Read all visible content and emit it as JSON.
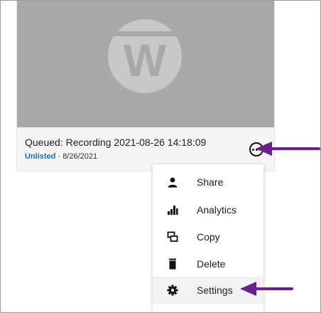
{
  "video": {
    "title": "Queued: Recording 2021-08-26 14:18:09",
    "visibility": "Unlisted",
    "separator": " · ",
    "date": "8/26/2021",
    "logo_letter": "W"
  },
  "menu": {
    "items": [
      {
        "label": "Share",
        "icon": "person-icon"
      },
      {
        "label": "Analytics",
        "icon": "bar-chart-icon"
      },
      {
        "label": "Copy",
        "icon": "copy-icon"
      },
      {
        "label": "Delete",
        "icon": "trash-icon"
      },
      {
        "label": "Settings",
        "icon": "gear-icon"
      }
    ],
    "highlighted": "Settings"
  },
  "colors": {
    "annotation_arrow": "#6a1f8f",
    "link_blue": "#1a6fae",
    "thumbnail_bg": "#a9a9a9"
  }
}
